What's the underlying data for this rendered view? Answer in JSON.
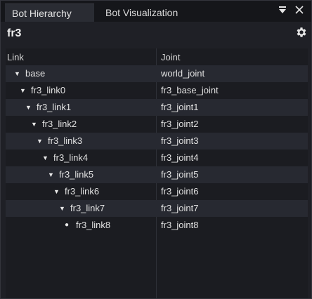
{
  "tabs": [
    {
      "label": "Bot Hierarchy",
      "active": true
    },
    {
      "label": "Bot Visualization",
      "active": false
    }
  ],
  "window_icons": {
    "menu": "menu-down-icon",
    "close": "close-icon"
  },
  "robot": {
    "name": "fr3",
    "settings_icon": "gear-icon"
  },
  "table": {
    "columns": {
      "link": "Link",
      "joint": "Joint"
    },
    "rows": [
      {
        "link": "base",
        "joint": "world_joint",
        "depth": 0,
        "marker": "▼"
      },
      {
        "link": "fr3_link0",
        "joint": "fr3_base_joint",
        "depth": 1,
        "marker": "▼"
      },
      {
        "link": "fr3_link1",
        "joint": "fr3_joint1",
        "depth": 2,
        "marker": "▼"
      },
      {
        "link": "fr3_link2",
        "joint": "fr3_joint2",
        "depth": 3,
        "marker": "▼"
      },
      {
        "link": "fr3_link3",
        "joint": "fr3_joint3",
        "depth": 4,
        "marker": "▼"
      },
      {
        "link": "fr3_link4",
        "joint": "fr3_joint4",
        "depth": 5,
        "marker": "▼"
      },
      {
        "link": "fr3_link5",
        "joint": "fr3_joint5",
        "depth": 6,
        "marker": "▼"
      },
      {
        "link": "fr3_link6",
        "joint": "fr3_joint6",
        "depth": 7,
        "marker": "▼"
      },
      {
        "link": "fr3_link7",
        "joint": "fr3_joint7",
        "depth": 8,
        "marker": "▼"
      },
      {
        "link": "fr3_link8",
        "joint": "fr3_joint8",
        "depth": 9,
        "marker": "●"
      }
    ]
  },
  "colors": {
    "background": "#1f2026",
    "tab_bar": "#15161a",
    "row_alt": "#272931"
  }
}
